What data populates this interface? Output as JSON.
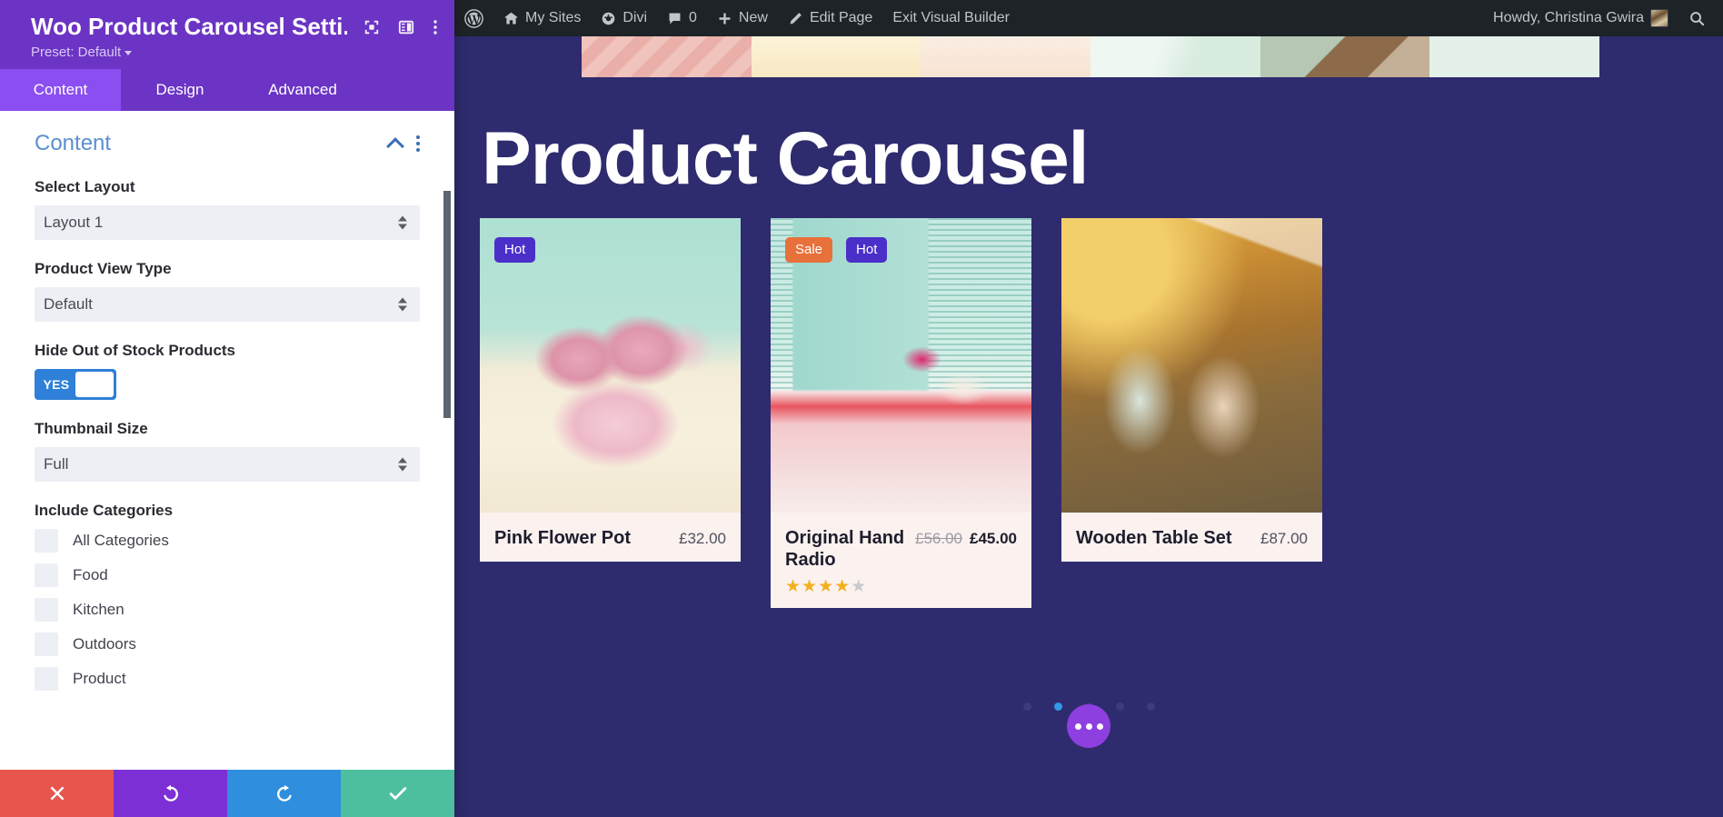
{
  "adminbar": {
    "wp_logo": "wordpress-logo-icon",
    "items": [
      {
        "label": "My Sites",
        "icon": "sites-icon"
      },
      {
        "label": "Divi",
        "icon": "divi-icon"
      },
      {
        "label": "0",
        "icon": "comment-icon"
      },
      {
        "label": "New",
        "icon": "plus-icon"
      },
      {
        "label": "Edit Page",
        "icon": "pencil-icon"
      },
      {
        "label": "Exit Visual Builder",
        "icon": ""
      }
    ],
    "howdy": "Howdy, Christina Gwira",
    "search_icon": "search-icon",
    "avatar": "user-avatar"
  },
  "panel": {
    "title": "Woo Product Carousel Setti...",
    "preset_label": "Preset: Default",
    "header_icons": [
      "focus-target-icon",
      "panel-layout-icon",
      "vertical-dots-icon"
    ],
    "tabs": [
      {
        "label": "Content",
        "active": true
      },
      {
        "label": "Design",
        "active": false
      },
      {
        "label": "Advanced",
        "active": false
      }
    ],
    "section": {
      "title": "Content",
      "collapse_icon": "chevron-up-icon",
      "menu_icon": "vertical-dots-icon"
    },
    "fields": {
      "select_layout": {
        "label": "Select Layout",
        "value": "Layout 1"
      },
      "product_view_type": {
        "label": "Product View Type",
        "value": "Default"
      },
      "hide_out_of_stock": {
        "label": "Hide Out of Stock Products",
        "value": "YES"
      },
      "thumbnail_size": {
        "label": "Thumbnail Size",
        "value": "Full"
      },
      "include_categories": {
        "label": "Include Categories",
        "options": [
          {
            "label": "All Categories",
            "checked": false
          },
          {
            "label": "Food",
            "checked": false
          },
          {
            "label": "Kitchen",
            "checked": false
          },
          {
            "label": "Outdoors",
            "checked": false
          },
          {
            "label": "Product",
            "checked": false
          }
        ]
      }
    },
    "footer": [
      {
        "name": "cancel-button",
        "icon": "close-x-icon",
        "color": "#e8554c"
      },
      {
        "name": "undo-button",
        "icon": "undo-arrow-icon",
        "color": "#7d2fd6"
      },
      {
        "name": "redo-button",
        "icon": "redo-arrow-icon",
        "color": "#2f8ede"
      },
      {
        "name": "save-button",
        "icon": "checkmark-icon",
        "color": "#4dbf9e"
      }
    ]
  },
  "canvas": {
    "heading": "Product Carousel",
    "background_color": "#2e2b6e",
    "products": [
      {
        "title": "Pink Flower Pot",
        "price": "£32.00",
        "old_price": "",
        "new_price": "",
        "badges": [
          {
            "label": "Hot",
            "type": "hot"
          }
        ],
        "rating": 0,
        "image": "pink-roses-in-polkadot-pot"
      },
      {
        "title": "Original Hand Radio",
        "price": "",
        "old_price": "£56.00",
        "new_price": "£45.00",
        "badges": [
          {
            "label": "Sale",
            "type": "sale"
          },
          {
            "label": "Hot",
            "type": "hot"
          }
        ],
        "rating": 4,
        "rating_max": 5,
        "image": "retro-mint-radio"
      },
      {
        "title": "Wooden Table Set",
        "price": "£87.00",
        "old_price": "",
        "new_price": "",
        "badges": [],
        "rating": 0,
        "image": "autumn-garden-chairs"
      }
    ],
    "carousel_dots": {
      "count": 5,
      "active_index": 1
    },
    "fab_icon": "three-dots-icon"
  }
}
